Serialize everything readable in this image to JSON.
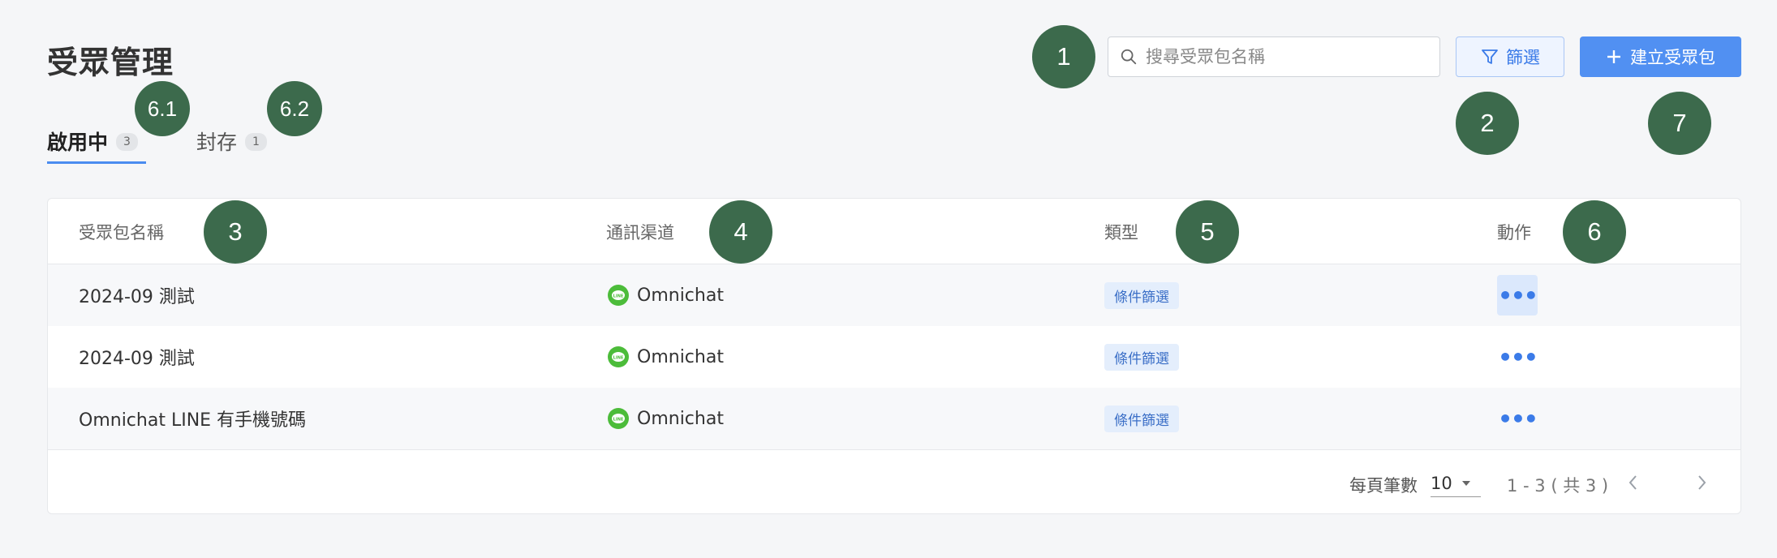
{
  "header": {
    "title": "受眾管理",
    "search_placeholder": "搜尋受眾包名稱",
    "filter_label": "篩選",
    "create_label": "建立受眾包"
  },
  "tabs": [
    {
      "label": "啟用中",
      "count": "3"
    },
    {
      "label": "封存",
      "count": "1"
    }
  ],
  "table": {
    "columns": [
      "受眾包名稱",
      "通訊渠道",
      "類型",
      "動作"
    ],
    "rows": [
      {
        "name": "2024-09 測試",
        "channel": "Omnichat",
        "type": "條件篩選"
      },
      {
        "name": "2024-09 測試",
        "channel": "Omnichat",
        "type": "條件篩選"
      },
      {
        "name": "Omnichat LINE 有手機號碼",
        "channel": "Omnichat",
        "type": "條件篩選"
      }
    ],
    "action_glyph": "•••"
  },
  "pagination": {
    "page_size_label": "每頁筆數",
    "page_size": "10",
    "range_text": "1 - 3 ( 共 3 )"
  },
  "markers": [
    "1",
    "2",
    "3",
    "4",
    "5",
    "6",
    "6.1",
    "6.2",
    "7"
  ],
  "colors": {
    "accent": "#5190f2",
    "marker": "#3c6a4c",
    "line_green": "#4cbc3a",
    "tag_bg": "#e4eefc"
  }
}
